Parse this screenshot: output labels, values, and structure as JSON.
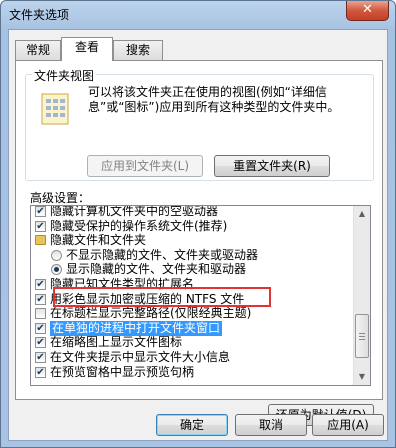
{
  "window": {
    "title": "文件夹选项",
    "close_label": "✕"
  },
  "tabs": [
    {
      "label": "常规"
    },
    {
      "label": "查看"
    },
    {
      "label": "搜索"
    }
  ],
  "folder_views": {
    "title": "文件夹视图",
    "description": "可以将该文件夹正在使用的视图(例如“详细信息”或“图标”)应用到所有这种类型的文件夹中。",
    "apply_button": "应用到文件夹(L)",
    "reset_button": "重置文件夹(R)"
  },
  "advanced": {
    "label": "高级设置：",
    "items": [
      {
        "kind": "checkbox",
        "checked": true,
        "indent": 0,
        "text": "隐藏计算机文件夹中的空驱动器"
      },
      {
        "kind": "checkbox",
        "checked": true,
        "indent": 0,
        "text": "隐藏受保护的操作系统文件(推荐)"
      },
      {
        "kind": "folder",
        "indent": 0,
        "text": "隐藏文件和文件夹"
      },
      {
        "kind": "radio",
        "checked": false,
        "indent": 1,
        "text": "不显示隐藏的文件、文件夹或驱动器"
      },
      {
        "kind": "radio",
        "checked": true,
        "indent": 1,
        "text": "显示隐藏的文件、文件夹和驱动器"
      },
      {
        "kind": "checkbox",
        "checked": true,
        "indent": 0,
        "text": "隐藏已知文件类型的扩展名"
      },
      {
        "kind": "checkbox",
        "checked": true,
        "indent": 0,
        "text": "用彩色显示加密或压缩的 NTFS 文件"
      },
      {
        "kind": "checkbox",
        "checked": false,
        "indent": 0,
        "text": "在标题栏显示完整路径(仅限经典主题)"
      },
      {
        "kind": "checkbox",
        "checked": true,
        "indent": 0,
        "text": "在单独的进程中打开文件夹窗口",
        "selected": true
      },
      {
        "kind": "checkbox",
        "checked": true,
        "indent": 0,
        "text": "在缩略图上显示文件图标"
      },
      {
        "kind": "checkbox",
        "checked": true,
        "indent": 0,
        "text": "在文件夹提示中显示文件大小信息"
      },
      {
        "kind": "checkbox",
        "checked": true,
        "indent": 0,
        "text": "在预览窗格中显示预览句柄"
      }
    ]
  },
  "buttons": {
    "restore_defaults": "还原为默认值(D)",
    "ok": "确定",
    "cancel": "取消",
    "apply": "应用(A)"
  },
  "colors": {
    "selection": "#3399ff",
    "annotation_box": "#e03434",
    "close_button": "#c33f26"
  }
}
